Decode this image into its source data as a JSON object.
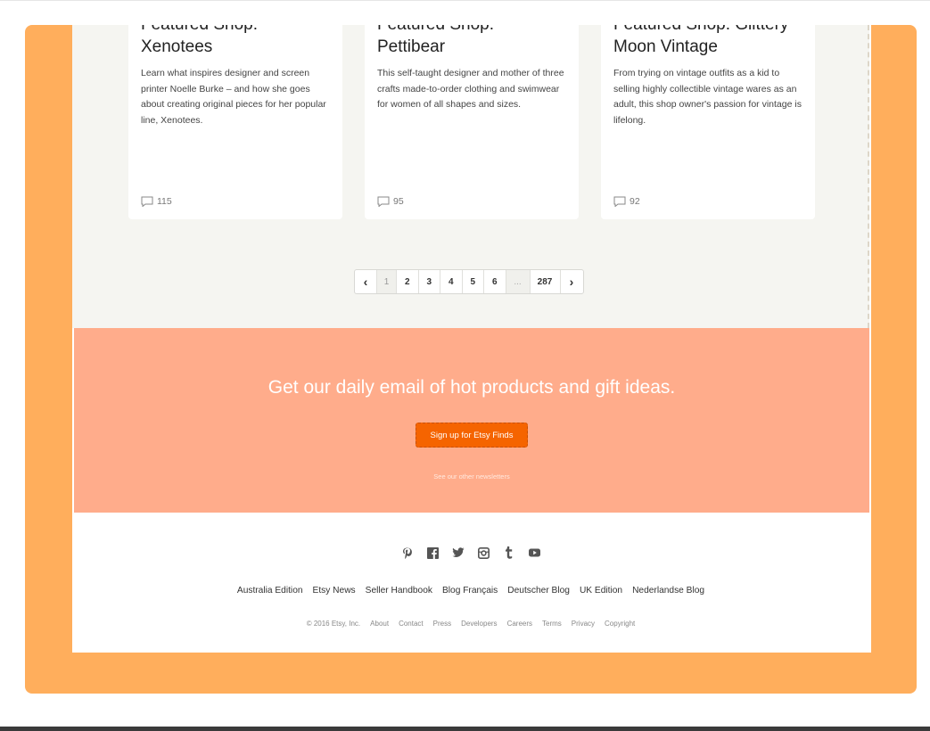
{
  "cards": [
    {
      "title_line1": "Featured Shop:",
      "title_line2": "Xenotees",
      "description": "Learn what inspires designer and screen printer Noelle Burke – and how she goes about creating original pieces for her popular line, Xenotees.",
      "comments": "115"
    },
    {
      "title_line1": "Featured Shop:",
      "title_line2": "Pettibear",
      "description": "This self-taught designer and mother of three crafts made-to-order clothing and swimwear for women of all shapes and sizes.",
      "comments": "95"
    },
    {
      "title_line1": "Featured Shop: Glittery",
      "title_line2": "Moon Vintage",
      "description": "From trying on vintage outfits as a kid to selling highly collectible vintage wares as an adult, this shop owner's passion for vintage is lifelong.",
      "comments": "92"
    }
  ],
  "pagination": {
    "prev": "‹",
    "pages": [
      "1",
      "2",
      "3",
      "4",
      "5",
      "6"
    ],
    "ellipsis": "...",
    "last": "287",
    "next": "›",
    "current": "1"
  },
  "newsletter": {
    "headline": "Get our daily email of hot products and gift ideas.",
    "button_label": "Sign up for Etsy Finds",
    "link": "See our other newsletters",
    "button_color": "#f56400",
    "background_color": "#ffac8b"
  },
  "social_icons": [
    "pinterest-icon",
    "facebook-icon",
    "twitter-icon",
    "instagram-icon",
    "tumblr-icon",
    "youtube-icon"
  ],
  "footer_links": [
    "Australia Edition",
    "Etsy News",
    "Seller Handbook",
    "Blog Français",
    "Deutscher Blog",
    "UK Edition",
    "Nederlandse Blog"
  ],
  "legal": {
    "copyright": "© 2016 Etsy, Inc.",
    "links": [
      "About",
      "Contact",
      "Press",
      "Developers",
      "Careers",
      "Terms",
      "Privacy",
      "Copyright"
    ]
  },
  "frame_color": "#ffae5c"
}
